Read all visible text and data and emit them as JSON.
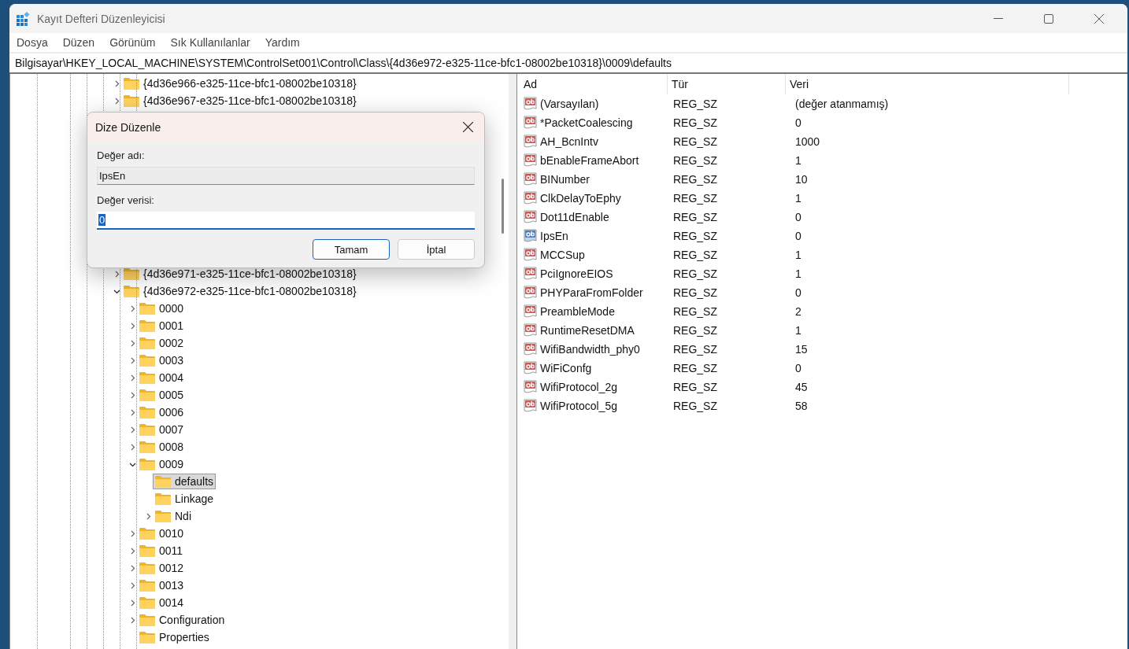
{
  "window": {
    "title": "Kayıt Defteri Düzenleyicisi"
  },
  "menu": [
    "Dosya",
    "Düzen",
    "Görünüm",
    "Sık Kullanılanlar",
    "Yardım"
  ],
  "address": "Bilgisayar\\HKEY_LOCAL_MACHINE\\SYSTEM\\ControlSet001\\Control\\Class\\{4d36e972-e325-11ce-bfc1-08002be10318}\\0009\\defaults",
  "tree": {
    "items": [
      {
        "label": "{4d36e966-e325-11ce-bfc1-08002be10318}",
        "expandable": true,
        "expanded": false,
        "selected": false
      },
      {
        "label": "{4d36e967-e325-11ce-bfc1-08002be10318}",
        "expandable": true,
        "expanded": false,
        "selected": false
      },
      {
        "label": "{4d36e971-e325-11ce-bfc1-08002be10318}",
        "expandable": true,
        "expanded": false,
        "selected": false
      },
      {
        "label": "{4d36e972-e325-11ce-bfc1-08002be10318}",
        "expandable": true,
        "expanded": true,
        "selected": false,
        "children": [
          {
            "label": "0000",
            "expandable": true,
            "expanded": false,
            "selected": false
          },
          {
            "label": "0001",
            "expandable": true,
            "expanded": false,
            "selected": false
          },
          {
            "label": "0002",
            "expandable": true,
            "expanded": false,
            "selected": false
          },
          {
            "label": "0003",
            "expandable": true,
            "expanded": false,
            "selected": false
          },
          {
            "label": "0004",
            "expandable": true,
            "expanded": false,
            "selected": false
          },
          {
            "label": "0005",
            "expandable": true,
            "expanded": false,
            "selected": false
          },
          {
            "label": "0006",
            "expandable": true,
            "expanded": false,
            "selected": false
          },
          {
            "label": "0007",
            "expandable": true,
            "expanded": false,
            "selected": false
          },
          {
            "label": "0008",
            "expandable": true,
            "expanded": false,
            "selected": false
          },
          {
            "label": "0009",
            "expandable": true,
            "expanded": true,
            "selected": false,
            "children": [
              {
                "label": "defaults",
                "expandable": false,
                "selected": true
              },
              {
                "label": "Linkage",
                "expandable": false,
                "selected": false
              },
              {
                "label": "Ndi",
                "expandable": true,
                "expanded": false,
                "selected": false
              }
            ]
          },
          {
            "label": "0010",
            "expandable": true,
            "expanded": false,
            "selected": false
          },
          {
            "label": "0011",
            "expandable": true,
            "expanded": false,
            "selected": false
          },
          {
            "label": "0012",
            "expandable": true,
            "expanded": false,
            "selected": false
          },
          {
            "label": "0013",
            "expandable": true,
            "expanded": false,
            "selected": false
          },
          {
            "label": "0014",
            "expandable": true,
            "expanded": false,
            "selected": false
          },
          {
            "label": "Configuration",
            "expandable": true,
            "expanded": false,
            "selected": false
          },
          {
            "label": "Properties",
            "expandable": false,
            "selected": false
          }
        ]
      }
    ]
  },
  "values": {
    "columns": [
      "Ad",
      "Tür",
      "Veri"
    ],
    "rows": [
      {
        "name": "(Varsayılan)",
        "type": "REG_SZ",
        "data": "(değer atanmamış)",
        "selected": false
      },
      {
        "name": "*PacketCoalescing",
        "type": "REG_SZ",
        "data": "0",
        "selected": false
      },
      {
        "name": "AH_BcnIntv",
        "type": "REG_SZ",
        "data": "1000",
        "selected": false
      },
      {
        "name": "bEnableFrameAbort",
        "type": "REG_SZ",
        "data": "1",
        "selected": false
      },
      {
        "name": "BINumber",
        "type": "REG_SZ",
        "data": "10",
        "selected": false
      },
      {
        "name": "ClkDelayToEphy",
        "type": "REG_SZ",
        "data": "1",
        "selected": false
      },
      {
        "name": "Dot11dEnable",
        "type": "REG_SZ",
        "data": "0",
        "selected": false
      },
      {
        "name": "IpsEn",
        "type": "REG_SZ",
        "data": "0",
        "selected": true
      },
      {
        "name": "MCCSup",
        "type": "REG_SZ",
        "data": "1",
        "selected": false
      },
      {
        "name": "PciIgnoreEIOS",
        "type": "REG_SZ",
        "data": "1",
        "selected": false
      },
      {
        "name": "PHYParaFromFolder",
        "type": "REG_SZ",
        "data": "0",
        "selected": false
      },
      {
        "name": "PreambleMode",
        "type": "REG_SZ",
        "data": "2",
        "selected": false
      },
      {
        "name": "RuntimeResetDMA",
        "type": "REG_SZ",
        "data": "1",
        "selected": false
      },
      {
        "name": "WifiBandwidth_phy0",
        "type": "REG_SZ",
        "data": "15",
        "selected": false
      },
      {
        "name": "WiFiConfg",
        "type": "REG_SZ",
        "data": "0",
        "selected": false
      },
      {
        "name": "WifiProtocol_2g",
        "type": "REG_SZ",
        "data": "45",
        "selected": false
      },
      {
        "name": "WifiProtocol_5g",
        "type": "REG_SZ",
        "data": "58",
        "selected": false
      }
    ]
  },
  "dialog": {
    "title": "Dize Düzenle",
    "name_label": "Değer adı:",
    "name_value": "IpsEn",
    "data_label": "Değer verisi:",
    "data_value": "0",
    "buttons": [
      {
        "label": "Tamam",
        "default": true
      },
      {
        "label": "İptal",
        "default": false
      }
    ]
  }
}
